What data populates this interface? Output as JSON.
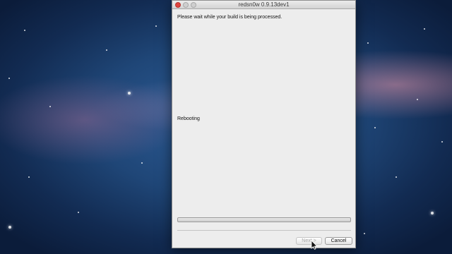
{
  "window": {
    "title": "redsn0w 0.9.13dev1"
  },
  "content": {
    "message": "Please wait while your build is being processed.",
    "status": "Rebooting",
    "progress": 0
  },
  "buttons": {
    "next_label": "Next >",
    "cancel_label": "Cancel"
  },
  "colors": {
    "close_button": "#e0443e",
    "progress_fill": "#3a78d4"
  }
}
